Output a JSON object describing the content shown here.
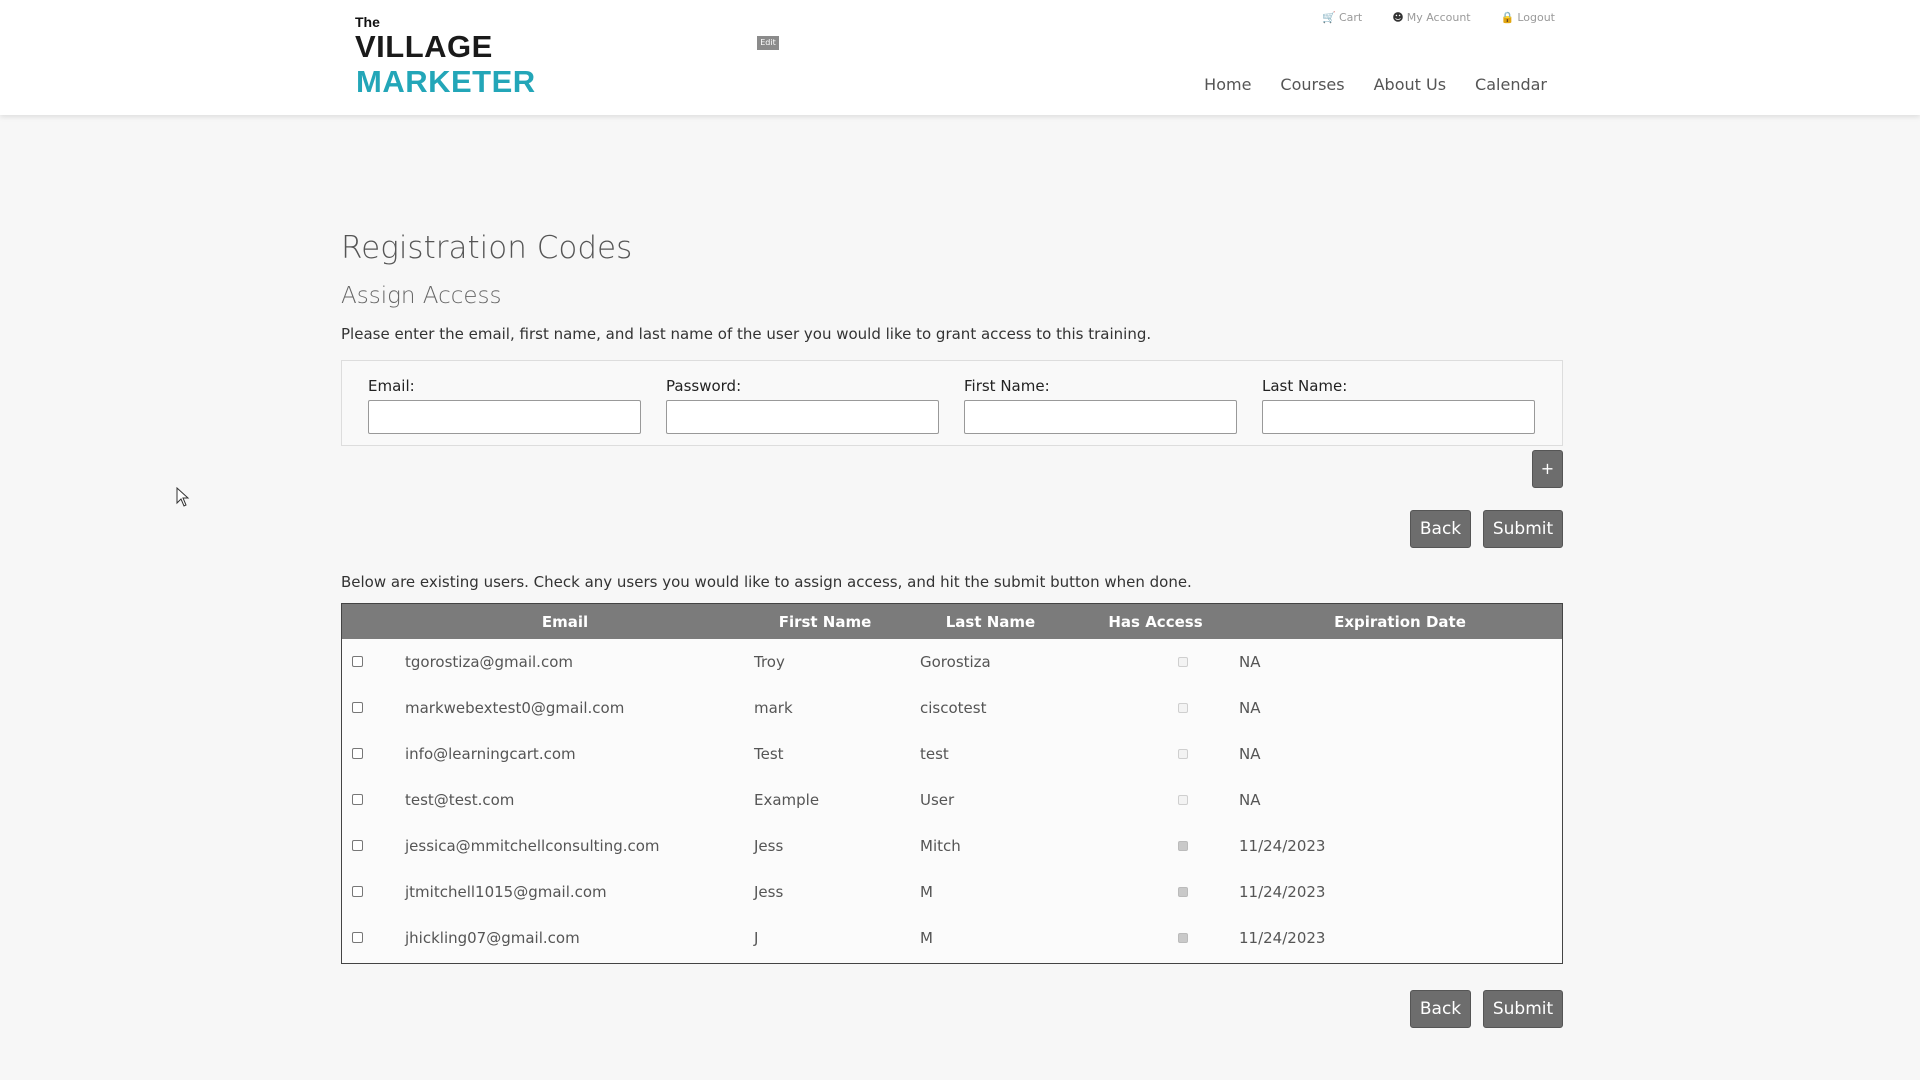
{
  "header": {
    "logo": {
      "line1": "The",
      "line2": "VILLAGE",
      "line3": "MARKETER"
    },
    "edit_badge": "Edit",
    "top_links": [
      {
        "label": "Cart",
        "icon": "cart-icon"
      },
      {
        "label": "My Account",
        "icon": "user-icon"
      },
      {
        "label": "Logout",
        "icon": "lock-icon"
      }
    ],
    "nav": [
      "Home",
      "Courses",
      "About Us",
      "Calendar"
    ]
  },
  "page": {
    "title": "Registration Codes",
    "subtitle": "Assign Access",
    "intro": "Please enter the email, first name, and last name of the user you would like to grant access to this training."
  },
  "form": {
    "fields": [
      {
        "label": "Email:",
        "value": ""
      },
      {
        "label": "Password:",
        "value": ""
      },
      {
        "label": "First Name:",
        "value": ""
      },
      {
        "label": "Last Name:",
        "value": ""
      }
    ],
    "add_button": "+",
    "back_button": "Back",
    "submit_button": "Submit"
  },
  "existing": {
    "text": "Below are existing users. Check any users you would like to assign access, and hit the submit button when done.",
    "columns": [
      "",
      "Email",
      "First Name",
      "Last Name",
      "Has Access",
      "Expiration Date"
    ],
    "rows": [
      {
        "email": "tgorostiza@gmail.com",
        "first": "Troy",
        "last": "Gorostiza",
        "has_access": false,
        "expiration": "NA"
      },
      {
        "email": "markwebextest0@gmail.com",
        "first": "mark",
        "last": "ciscotest",
        "has_access": false,
        "expiration": "NA"
      },
      {
        "email": "info@learningcart.com",
        "first": "Test",
        "last": "test",
        "has_access": false,
        "expiration": "NA"
      },
      {
        "email": "test@test.com",
        "first": "Example",
        "last": "User",
        "has_access": false,
        "expiration": "NA"
      },
      {
        "email": "jessica@mmitchellconsulting.com",
        "first": "Jess",
        "last": "Mitch",
        "has_access": true,
        "expiration": "11/24/2023"
      },
      {
        "email": "jtmitchell1015@gmail.com",
        "first": "Jess",
        "last": "M",
        "has_access": true,
        "expiration": "11/24/2023"
      },
      {
        "email": "jhickling07@gmail.com",
        "first": "J",
        "last": "M",
        "has_access": true,
        "expiration": "11/24/2023"
      }
    ],
    "back_button": "Back",
    "submit_button": "Submit"
  },
  "colors": {
    "brand_dark": "#1a1a1a",
    "brand_teal": "#23a6b8",
    "button_bg": "#6d6d6d",
    "table_header_bg": "#7b7b7b"
  }
}
